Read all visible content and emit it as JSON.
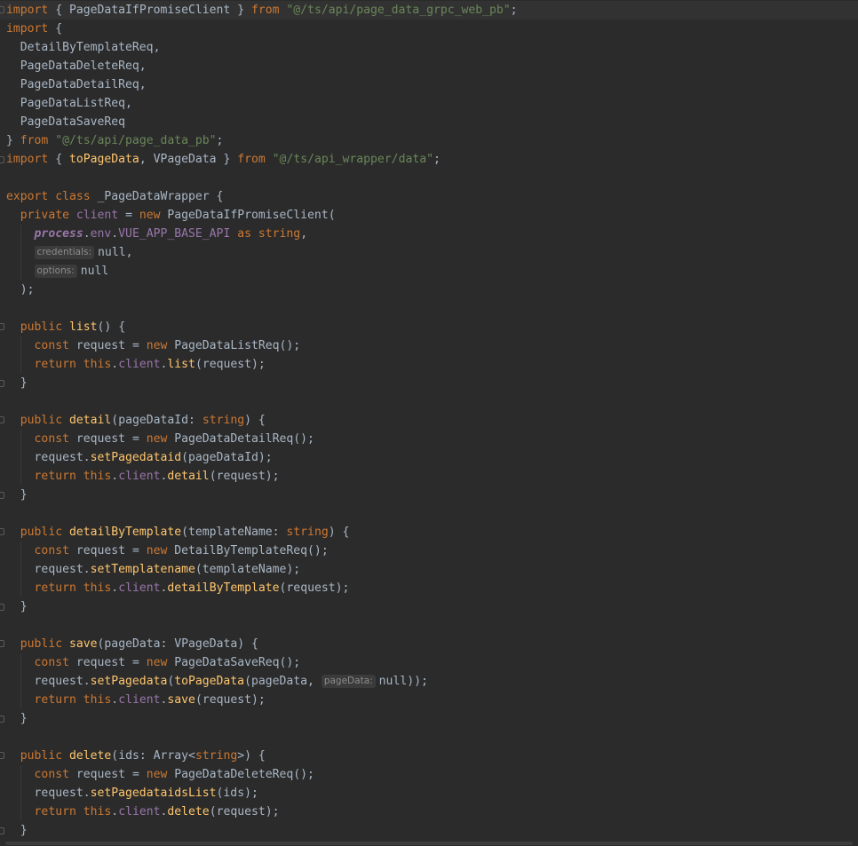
{
  "editor": {
    "language": "typescript",
    "lines": [
      "import { PageDataIfPromiseClient } from \"@/ts/api/page_data_grpc_web_pb\";",
      "import {",
      "  DetailByTemplateReq,",
      "  PageDataDeleteReq,",
      "  PageDataDetailReq,",
      "  PageDataListReq,",
      "  PageDataSaveReq",
      "} from \"@/ts/api/page_data_pb\";",
      "import { toPageData, VPageData } from \"@/ts/api_wrapper/data\";",
      "",
      "export class _PageDataWrapper {",
      "  private client = new PageDataIfPromiseClient(",
      "    process.env.VUE_APP_BASE_API as string,",
      "    credentials: null,",
      "    options: null",
      "  );",
      "",
      "  public list() {",
      "    const request = new PageDataListReq();",
      "    return this.client.list(request);",
      "  }",
      "",
      "  public detail(pageDataId: string) {",
      "    const request = new PageDataDetailReq();",
      "    request.setPagedataid(pageDataId);",
      "    return this.client.detail(request);",
      "  }",
      "",
      "  public detailByTemplate(templateName: string) {",
      "    const request = new DetailByTemplateReq();",
      "    request.setTemplatename(templateName);",
      "    return this.client.detailByTemplate(request);",
      "  }",
      "",
      "  public save(pageData: VPageData) {",
      "    const request = new PageDataSaveReq();",
      "    request.setPagedata(toPageData(pageData, pageData: null));",
      "    return this.client.save(request);",
      "  }",
      "",
      "  public delete(ids: Array<string>) {",
      "    const request = new PageDataDeleteReq();",
      "    request.setPagedataidsList(ids);",
      "    return this.client.delete(request);",
      "  }"
    ],
    "inlay_hints": [
      {
        "line": 13,
        "label": "credentials:"
      },
      {
        "line": 14,
        "label": "options:"
      },
      {
        "line": 36,
        "label": "pageData:"
      }
    ],
    "current_line": 0,
    "fold_markers": [
      {
        "line": 0,
        "kind": "start"
      },
      {
        "line": 8,
        "kind": "end"
      },
      {
        "line": 17,
        "kind": "start"
      },
      {
        "line": 20,
        "kind": "end"
      },
      {
        "line": 22,
        "kind": "start"
      },
      {
        "line": 26,
        "kind": "end"
      },
      {
        "line": 28,
        "kind": "start"
      },
      {
        "line": 32,
        "kind": "end"
      },
      {
        "line": 34,
        "kind": "start"
      },
      {
        "line": 38,
        "kind": "end"
      },
      {
        "line": 40,
        "kind": "start"
      },
      {
        "line": 44,
        "kind": "end"
      }
    ],
    "colors": {
      "background": "#2b2b2b",
      "current_line": "#323232",
      "text": "#a9b7c6",
      "keyword": "#cc7832",
      "string": "#6a8759",
      "function": "#ffc66d",
      "property": "#9876aa",
      "inlay_hint_bg": "#3b3b3b",
      "inlay_hint_text": "#8c8c8c"
    }
  }
}
